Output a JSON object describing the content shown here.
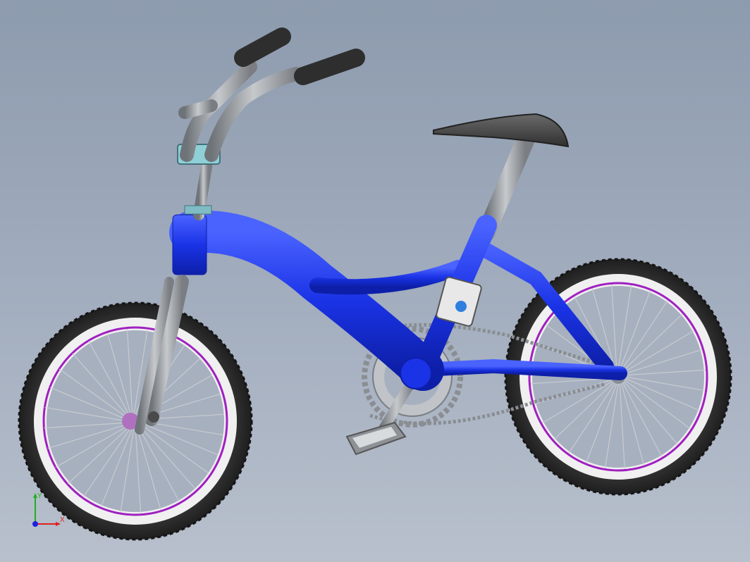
{
  "viewport": {
    "colors": {
      "frame": "#1a33e6",
      "frame_dark": "#0d1fa8",
      "tire": "#2b2b2b",
      "rim_white": "#f2f2f2",
      "rim_purple": "#a020c0",
      "metal": "#9a9ea3",
      "grip": "#3a3a3a",
      "seat": "#4a4a4a"
    }
  },
  "model": {
    "name_icon": "bicycle-model"
  },
  "triad": {
    "x_label": "X",
    "y_label": "Y",
    "x_color": "#e02020",
    "y_color": "#20b020",
    "z_color": "#2020e0"
  }
}
